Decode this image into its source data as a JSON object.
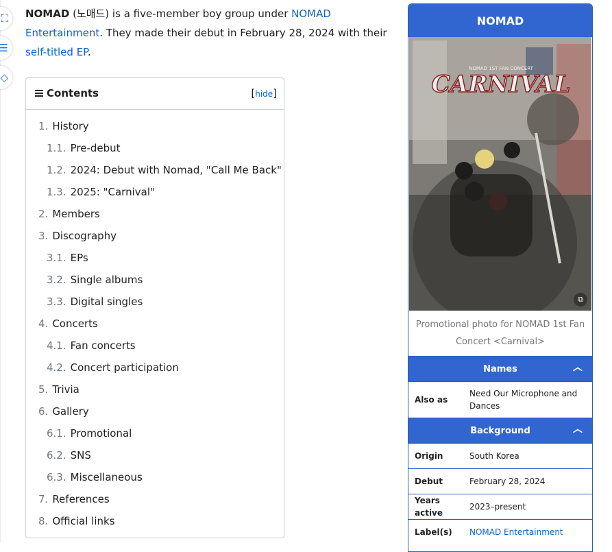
{
  "intro": {
    "name": "NOMAD",
    "korean": " (노매드) is a five-member boy group under ",
    "agency_link": "NOMAD Entertainment",
    "middle": ". They made their debut in February 28, 2024 with their ",
    "ep_link": "self-titled EP",
    "end": "."
  },
  "toc": {
    "title": "Contents",
    "hide_open": "[",
    "hide_label": "hide",
    "hide_close": "]",
    "items": [
      {
        "num": "1.",
        "label": "History",
        "level": 1
      },
      {
        "num": "1.1.",
        "label": "Pre-debut",
        "level": 2
      },
      {
        "num": "1.2.",
        "label": "2024: Debut with Nomad, \"Call Me Back\"",
        "level": 2
      },
      {
        "num": "1.3.",
        "label": "2025: \"Carnival\"",
        "level": 2
      },
      {
        "num": "2.",
        "label": "Members",
        "level": 1
      },
      {
        "num": "3.",
        "label": "Discography",
        "level": 1
      },
      {
        "num": "3.1.",
        "label": "EPs",
        "level": 2
      },
      {
        "num": "3.2.",
        "label": "Single albums",
        "level": 2
      },
      {
        "num": "3.3.",
        "label": "Digital singles",
        "level": 2
      },
      {
        "num": "4.",
        "label": "Concerts",
        "level": 1
      },
      {
        "num": "4.1.",
        "label": "Fan concerts",
        "level": 2
      },
      {
        "num": "4.2.",
        "label": "Concert participation",
        "level": 2
      },
      {
        "num": "5.",
        "label": "Trivia",
        "level": 1
      },
      {
        "num": "6.",
        "label": "Gallery",
        "level": 1
      },
      {
        "num": "6.1.",
        "label": "Promotional",
        "level": 2
      },
      {
        "num": "6.2.",
        "label": "SNS",
        "level": 2
      },
      {
        "num": "6.3.",
        "label": "Miscellaneous",
        "level": 2
      },
      {
        "num": "7.",
        "label": "References",
        "level": 1
      },
      {
        "num": "8.",
        "label": "Official links",
        "level": 1
      }
    ]
  },
  "infobox": {
    "title": "NOMAD",
    "poster_text": "CARNIVAL",
    "poster_subtitle": "NOMAD 1ST FAN CONCERT",
    "caption": "Promotional photo for NOMAD 1st Fan Concert <Carnival>",
    "names_header": "Names",
    "background_header": "Background",
    "rows_names": [
      {
        "label": "Also as",
        "value": "Need Our Microphone and Dances",
        "link": false
      }
    ],
    "rows_background": [
      {
        "label": "Origin",
        "value": "South Korea",
        "link": false
      },
      {
        "label": "Debut",
        "value": "February 28, 2024",
        "link": false
      },
      {
        "label": "Years active",
        "value": "2023–present",
        "link": false
      },
      {
        "label": "Label(s)",
        "value": "NOMAD Entertainment",
        "link": true
      }
    ]
  },
  "colors": {
    "accent": "#3165cf",
    "link": "#0b62c9"
  }
}
